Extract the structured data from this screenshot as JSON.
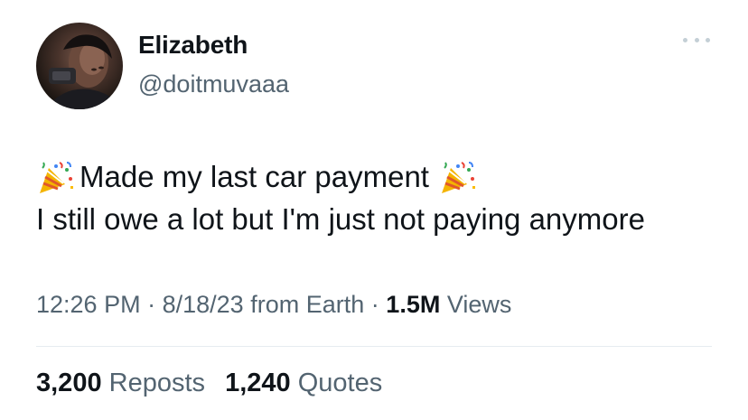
{
  "author": {
    "name": "Elizabeth",
    "handle": "@doitmuvaaa"
  },
  "tweet": {
    "line1": "Made my last car payment",
    "line2": "I still owe a lot but I'm just not paying anymore",
    "emoji_icon": "party-popper-icon"
  },
  "meta": {
    "time": "12:26 PM",
    "separator1": "·",
    "date": "8/18/23",
    "source": "from Earth",
    "separator2": "·",
    "views_count": "1.5M",
    "views_label": "Views"
  },
  "stats": {
    "reposts_count": "3,200",
    "reposts_label": "Reposts",
    "quotes_count": "1,240",
    "quotes_label": "Quotes"
  },
  "colors": {
    "text_primary": "#0f1419",
    "text_secondary": "#536471",
    "divider": "#e6ecf0"
  }
}
